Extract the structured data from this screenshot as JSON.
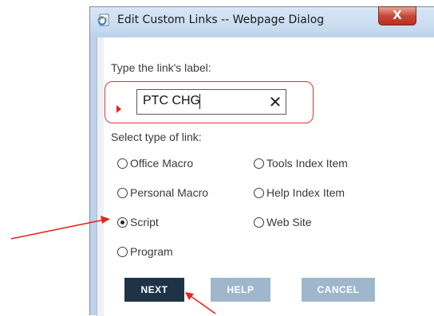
{
  "dialog": {
    "title": "Edit Custom Links -- Webpage Dialog",
    "close_label": "X"
  },
  "form": {
    "link_label_prompt": "Type the link's label:",
    "link_label_value": "PTC CHG",
    "clear_symbol": "✕",
    "type_prompt": "Select type of link:"
  },
  "link_types": [
    {
      "label": "Office Macro",
      "checked": false
    },
    {
      "label": "Tools Index Item",
      "checked": false
    },
    {
      "label": "Personal Macro",
      "checked": false
    },
    {
      "label": "Help Index Item",
      "checked": false
    },
    {
      "label": "Script",
      "checked": true
    },
    {
      "label": "Web Site",
      "checked": false
    },
    {
      "label": "Program",
      "checked": false
    }
  ],
  "buttons": {
    "next": "NEXT",
    "help": "HELP",
    "cancel": "CANCEL"
  },
  "colors": {
    "annotation": "#e2261f",
    "primary_button": "#1e3347",
    "secondary_button": "#9fb6cc"
  }
}
